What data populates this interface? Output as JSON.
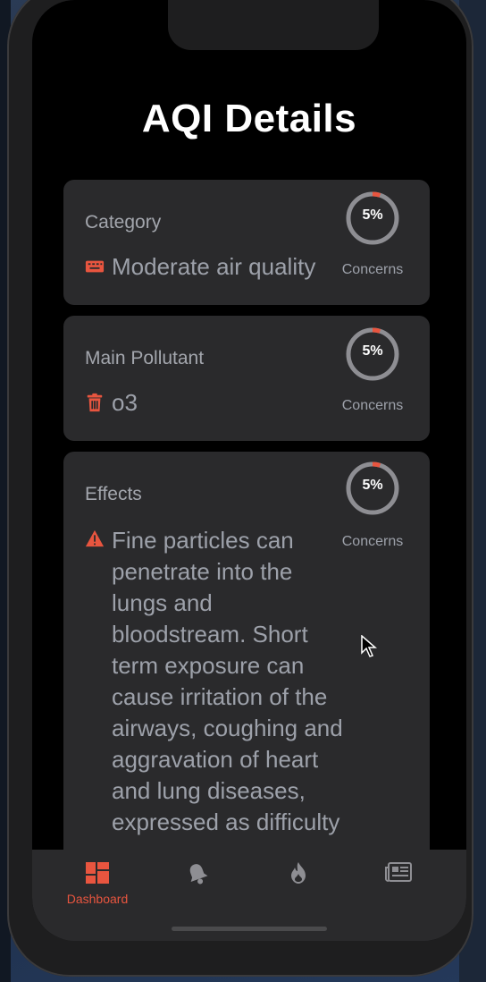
{
  "header": {
    "title": "AQI Details"
  },
  "cards": [
    {
      "label": "Category",
      "value": "Moderate air quality",
      "icon": "keyboard-icon",
      "percent": "5%",
      "percent_value": 0.05,
      "concerns_label": "Concerns"
    },
    {
      "label": "Main Pollutant",
      "value": "o3",
      "icon": "trash-icon",
      "percent": "5%",
      "percent_value": 0.05,
      "concerns_label": "Concerns"
    },
    {
      "label": "Effects",
      "value": "Fine particles can penetrate into the lungs and bloodstream. Short term exposure can cause irritation of the airways, coughing and aggravation of heart and lung diseases, expressed as difficulty",
      "icon": "warning-icon",
      "percent": "5%",
      "percent_value": 0.05,
      "concerns_label": "Concerns"
    }
  ],
  "tabbar": {
    "tabs": [
      {
        "label": "Dashboard",
        "icon": "dashboard-icon",
        "active": true
      },
      {
        "label": "",
        "icon": "bell-icon",
        "active": false
      },
      {
        "label": "",
        "icon": "fire-icon",
        "active": false
      },
      {
        "label": "",
        "icon": "newspaper-icon",
        "active": false
      }
    ]
  },
  "colors": {
    "accent": "#e8553f",
    "card_bg": "#2a2a2c",
    "screen_bg": "#000000",
    "ring_track": "#8e8e93"
  }
}
